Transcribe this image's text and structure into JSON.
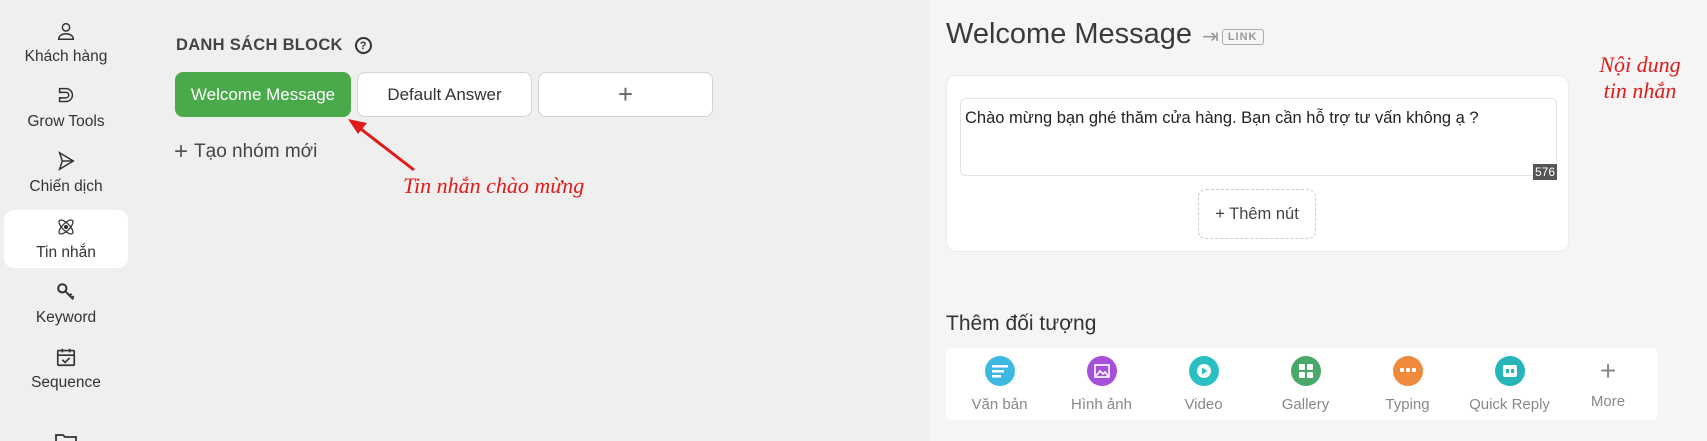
{
  "sidebar": {
    "items": [
      {
        "label": "Khách hàng",
        "icon": "user-icon"
      },
      {
        "label": "Grow Tools",
        "icon": "magnet-icon"
      },
      {
        "label": "Chiến dịch",
        "icon": "send-icon"
      },
      {
        "label": "Tin nhắn",
        "icon": "atom-icon",
        "active": true
      },
      {
        "label": "Keyword",
        "icon": "key-icon"
      },
      {
        "label": "Sequence",
        "icon": "calendar-check-icon"
      }
    ]
  },
  "blocks": {
    "title": "DANH SÁCH BLOCK",
    "help": "?",
    "items": [
      {
        "label": "Welcome Message",
        "selected": true
      },
      {
        "label": "Default Answer",
        "selected": false
      },
      {
        "label": "+",
        "selected": false
      }
    ],
    "new_group": "Tạo nhóm mới",
    "new_group_plus": "+"
  },
  "annotations": {
    "welcome": "Tin nhắn chào mừng",
    "content_line1": "Nội dung",
    "content_line2": "tin nhắn"
  },
  "editor": {
    "title": "Welcome Message",
    "link_badge": "LINK",
    "message_text": "Chào mừng bạn ghé thăm cửa hàng. Bạn cần hỗ trợ tư vấn không ạ ?",
    "char_counter": "576",
    "add_button": "+ Thêm nút"
  },
  "objects": {
    "title": "Thêm đối tượng",
    "tiles": [
      {
        "label": "Văn bản",
        "icon": "text-icon",
        "color": "#3db8e0"
      },
      {
        "label": "Hình ảnh",
        "icon": "image-icon",
        "color": "#a64fd8"
      },
      {
        "label": "Video",
        "icon": "video-play-icon",
        "color": "#2bbfc4"
      },
      {
        "label": "Gallery",
        "icon": "gallery-grid-icon",
        "color": "#4aa86a"
      },
      {
        "label": "Typing",
        "icon": "typing-dots-icon",
        "color": "#f08a3c"
      },
      {
        "label": "Quick Reply",
        "icon": "quick-reply-icon",
        "color": "#26b5b8"
      },
      {
        "label": "More",
        "icon": "plus-icon"
      }
    ]
  },
  "colors": {
    "accent_green": "#4aaa4b",
    "annotation_red": "#e01b1b"
  }
}
